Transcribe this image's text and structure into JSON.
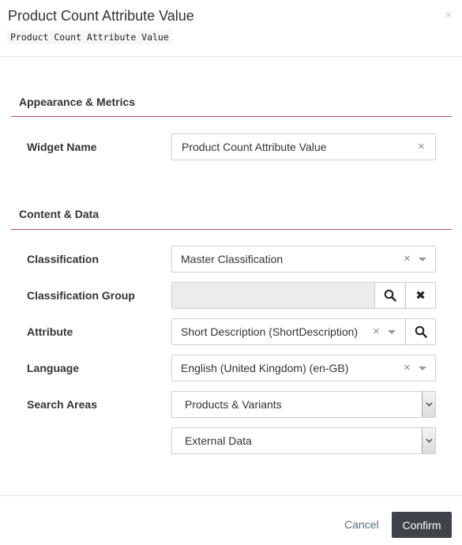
{
  "dialog": {
    "title": "Product Count Attribute Value",
    "subtitle": "Product Count Attribute Value",
    "close_glyph": "×"
  },
  "sections": [
    {
      "title": "Appearance & Metrics"
    },
    {
      "title": "Content & Data"
    }
  ],
  "widget_name": {
    "label": "Widget Name",
    "value": "Product Count Attribute Value",
    "clear_glyph": "×"
  },
  "classification": {
    "label": "Classification",
    "value": "Master Classification",
    "clear_glyph": "×"
  },
  "classification_group": {
    "label": "Classification Group",
    "value": "",
    "remove_glyph": "✖"
  },
  "attribute": {
    "label": "Attribute",
    "value": "Short Description (ShortDescription)",
    "clear_glyph": "×"
  },
  "language": {
    "label": "Language",
    "value": "English (United Kingdom) (en-GB)",
    "clear_glyph": "×"
  },
  "search_areas": {
    "label": "Search Areas",
    "selects": [
      "Products & Variants",
      "External Data"
    ]
  },
  "footer": {
    "cancel_label": "Cancel",
    "confirm_label": "Confirm"
  },
  "icons": {
    "search": "search-icon",
    "remove": "remove-icon",
    "caret": "caret-down-icon"
  },
  "colors": {
    "section_rule": "#b8456a",
    "confirm_bg": "#3e4349",
    "cancel_text": "#5a7080"
  }
}
